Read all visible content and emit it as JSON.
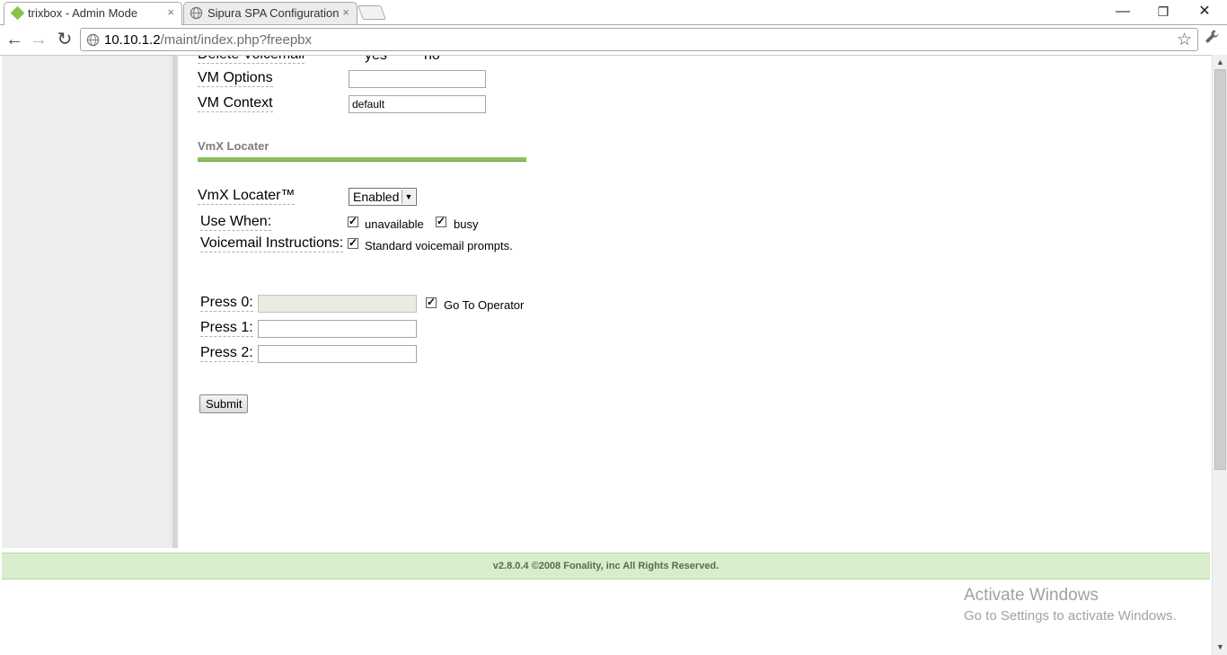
{
  "browser": {
    "tabs": [
      {
        "title": "trixbox - Admin Mode",
        "close": "×",
        "active": true
      },
      {
        "title": "Sipura SPA Configuration",
        "close": "×",
        "active": false
      }
    ],
    "window_controls": {
      "minimize": "—",
      "restore": "❐",
      "close": "✕"
    },
    "nav": {
      "back": "←",
      "forward": "→",
      "reload": "↻"
    },
    "address": {
      "host": "10.10.1.2",
      "path": "/maint/index.php?freepbx"
    },
    "star": "☆",
    "wrench": "🔧"
  },
  "form": {
    "delete_voicemail": {
      "label": "Delete Voicemail",
      "yes": "yes",
      "no": "no"
    },
    "vm_options": {
      "label": "VM Options",
      "value": ""
    },
    "vm_context": {
      "label": "VM Context",
      "value": "default"
    },
    "section_title": "VmX Locater",
    "vmx_locater": {
      "label": "VmX Locater™",
      "selected": "Enabled"
    },
    "use_when": {
      "label": "Use When:",
      "unavailable": "unavailable",
      "busy": "busy"
    },
    "voicemail_instructions": {
      "label": "Voicemail Instructions:",
      "option": "Standard voicemail prompts."
    },
    "press0": {
      "label": "Press 0:",
      "value": "",
      "operator": "Go To Operator"
    },
    "press1": {
      "label": "Press 1:",
      "value": ""
    },
    "press2": {
      "label": "Press 2:",
      "value": ""
    },
    "submit": "Submit",
    "check_mark": "✓"
  },
  "footer": "v2.8.0.4 ©2008 Fonality, inc All Rights Reserved.",
  "watermark": {
    "line1": "Activate Windows",
    "line2": "Go to Settings to activate Windows."
  },
  "scrollbar": {
    "up": "▲",
    "down": "▼"
  },
  "select_arrow": "▼"
}
